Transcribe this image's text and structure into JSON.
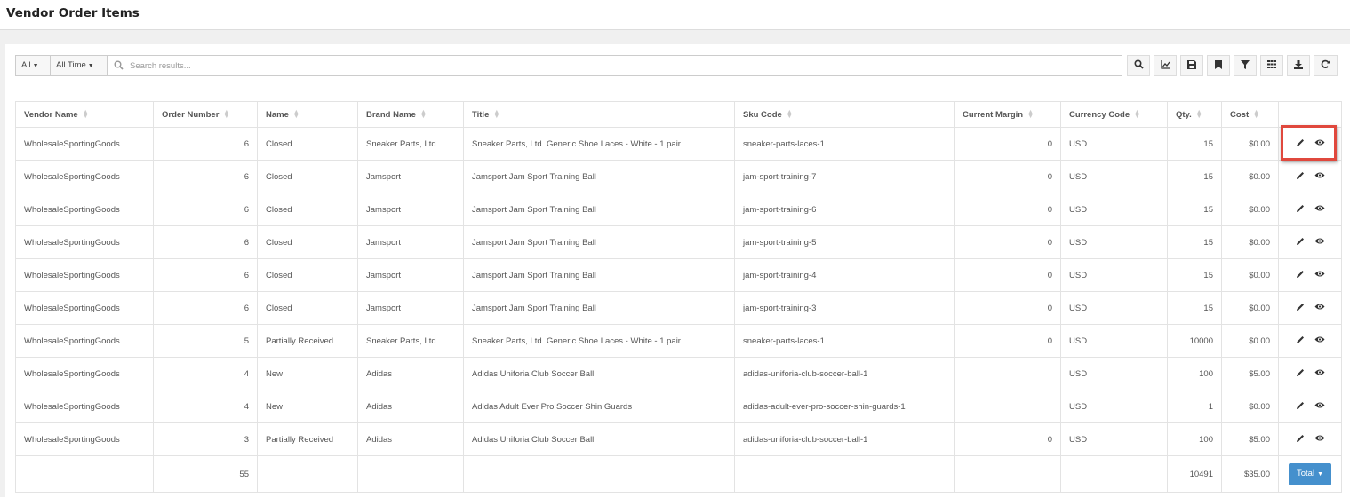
{
  "page": {
    "title": "Vendor Order Items"
  },
  "toolbar": {
    "filter_all": "All",
    "filter_time": "All Time",
    "search_placeholder": "Search results...",
    "buttons": [
      "search-icon",
      "chart-icon",
      "save-icon",
      "bookmark-icon",
      "filter-icon",
      "columns-icon",
      "download-icon",
      "refresh-icon"
    ]
  },
  "table": {
    "columns": [
      "Vendor Name",
      "Order Number",
      "Name",
      "Brand Name",
      "Title",
      "Sku Code",
      "Current Margin",
      "Currency Code",
      "Qty.",
      "Cost"
    ],
    "rows": [
      [
        "WholesaleSportingGoods",
        "6",
        "Closed",
        "Sneaker Parts, Ltd.",
        "Sneaker Parts, Ltd. Generic Shoe Laces - White - 1 pair",
        "sneaker-parts-laces-1",
        "0",
        "USD",
        "15",
        "$0.00"
      ],
      [
        "WholesaleSportingGoods",
        "6",
        "Closed",
        "Jamsport",
        "Jamsport Jam Sport Training Ball",
        "jam-sport-training-7",
        "0",
        "USD",
        "15",
        "$0.00"
      ],
      [
        "WholesaleSportingGoods",
        "6",
        "Closed",
        "Jamsport",
        "Jamsport Jam Sport Training Ball",
        "jam-sport-training-6",
        "0",
        "USD",
        "15",
        "$0.00"
      ],
      [
        "WholesaleSportingGoods",
        "6",
        "Closed",
        "Jamsport",
        "Jamsport Jam Sport Training Ball",
        "jam-sport-training-5",
        "0",
        "USD",
        "15",
        "$0.00"
      ],
      [
        "WholesaleSportingGoods",
        "6",
        "Closed",
        "Jamsport",
        "Jamsport Jam Sport Training Ball",
        "jam-sport-training-4",
        "0",
        "USD",
        "15",
        "$0.00"
      ],
      [
        "WholesaleSportingGoods",
        "6",
        "Closed",
        "Jamsport",
        "Jamsport Jam Sport Training Ball",
        "jam-sport-training-3",
        "0",
        "USD",
        "15",
        "$0.00"
      ],
      [
        "WholesaleSportingGoods",
        "5",
        "Partially Received",
        "Sneaker Parts, Ltd.",
        "Sneaker Parts, Ltd. Generic Shoe Laces - White - 1 pair",
        "sneaker-parts-laces-1",
        "0",
        "USD",
        "10000",
        "$0.00"
      ],
      [
        "WholesaleSportingGoods",
        "4",
        "New",
        "Adidas",
        "Adidas Uniforia Club Soccer Ball",
        "adidas-uniforia-club-soccer-ball-1",
        "",
        "USD",
        "100",
        "$5.00"
      ],
      [
        "WholesaleSportingGoods",
        "4",
        "New",
        "Adidas",
        "Adidas Adult Ever Pro Soccer Shin Guards",
        "adidas-adult-ever-pro-soccer-shin-guards-1",
        "",
        "USD",
        "1",
        "$0.00"
      ],
      [
        "WholesaleSportingGoods",
        "3",
        "Partially Received",
        "Adidas",
        "Adidas Uniforia Club Soccer Ball",
        "adidas-uniforia-club-soccer-ball-1",
        "0",
        "USD",
        "100",
        "$5.00"
      ]
    ],
    "footer": {
      "order_number_total": "55",
      "qty_total": "10491",
      "cost_total": "$35.00",
      "total_button": "Total"
    }
  },
  "colors": {
    "highlight": "#e0483d",
    "primary_button": "#4590cd"
  }
}
